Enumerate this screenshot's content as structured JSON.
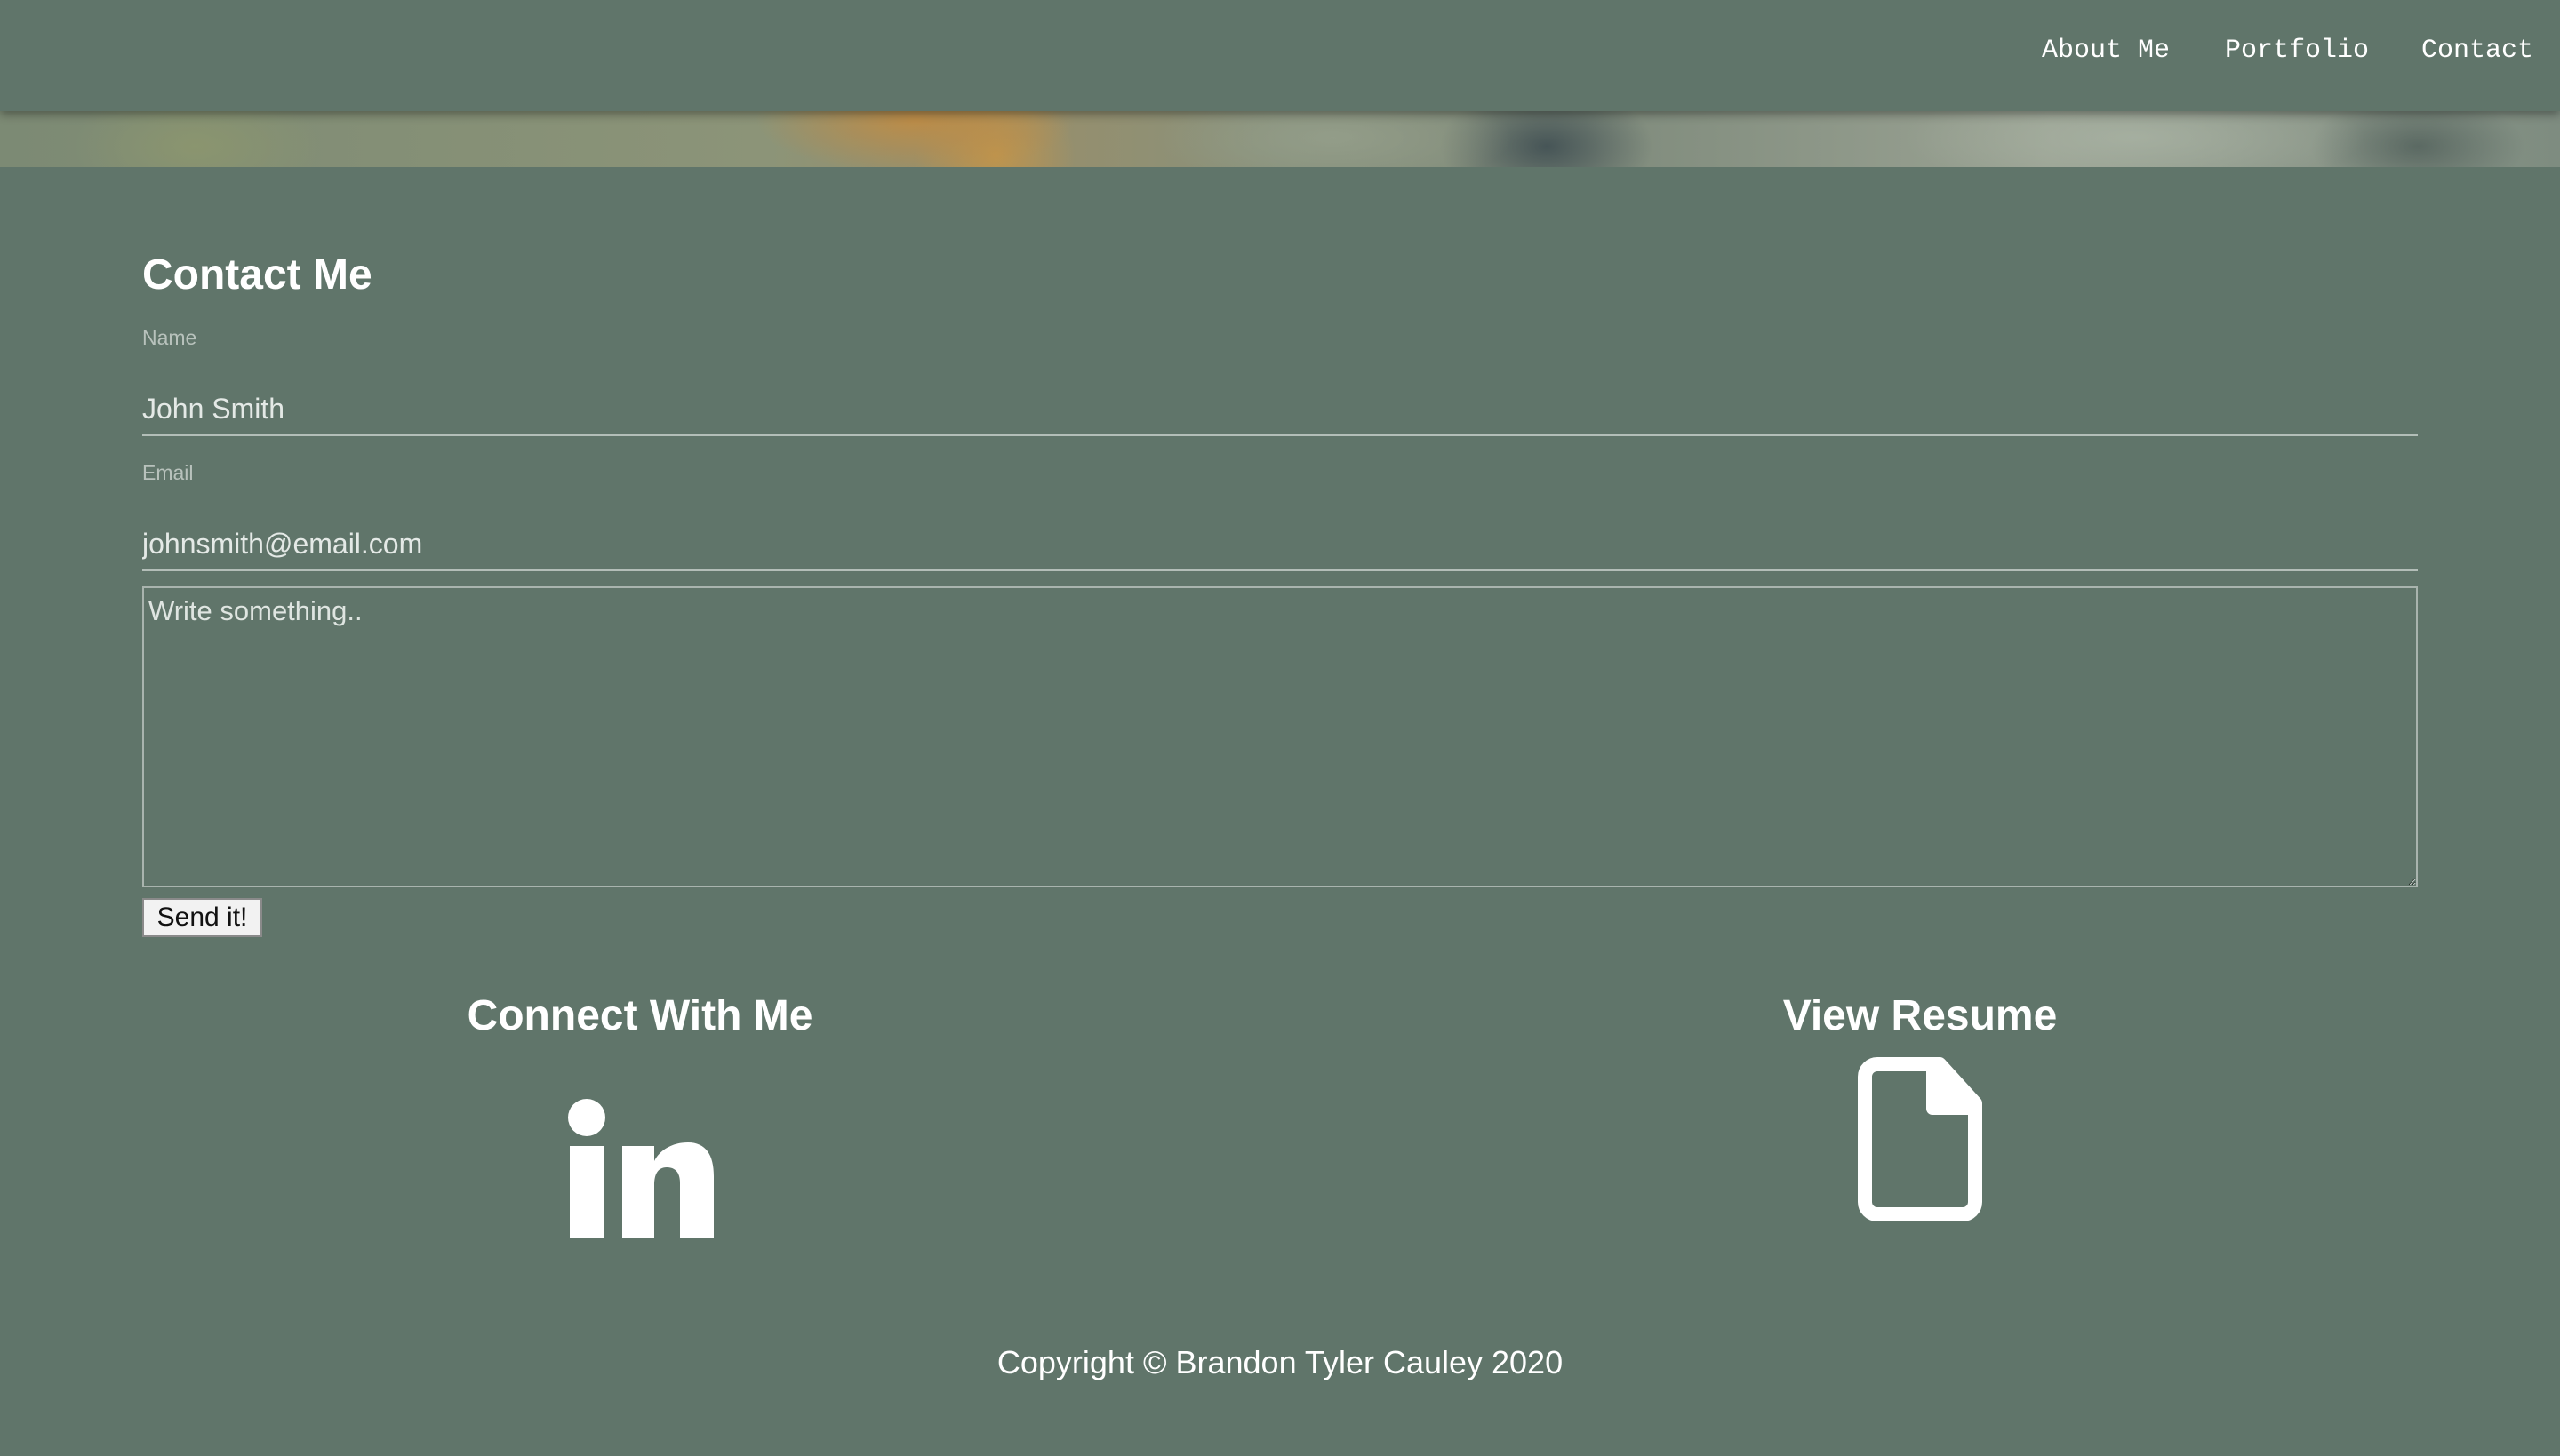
{
  "nav": {
    "links": [
      {
        "label": "About Me"
      },
      {
        "label": "Portfolio"
      },
      {
        "label": "Contact"
      }
    ]
  },
  "contact": {
    "title": "Contact Me",
    "name_label": "Name",
    "name_placeholder": "John Smith",
    "email_label": "Email",
    "email_placeholder": "johnsmith@email.com",
    "message_placeholder": "Write something..",
    "send_label": "Send it!"
  },
  "connect": {
    "heading": "Connect With Me",
    "icon": "linkedin-icon"
  },
  "resume": {
    "heading": "View Resume",
    "icon": "file-icon"
  },
  "footer": {
    "copyright": "Copyright © Brandon Tyler Cauley 2020"
  },
  "colors": {
    "background": "#60756a",
    "text": "#ffffff",
    "input_line": "#b3beb8"
  }
}
